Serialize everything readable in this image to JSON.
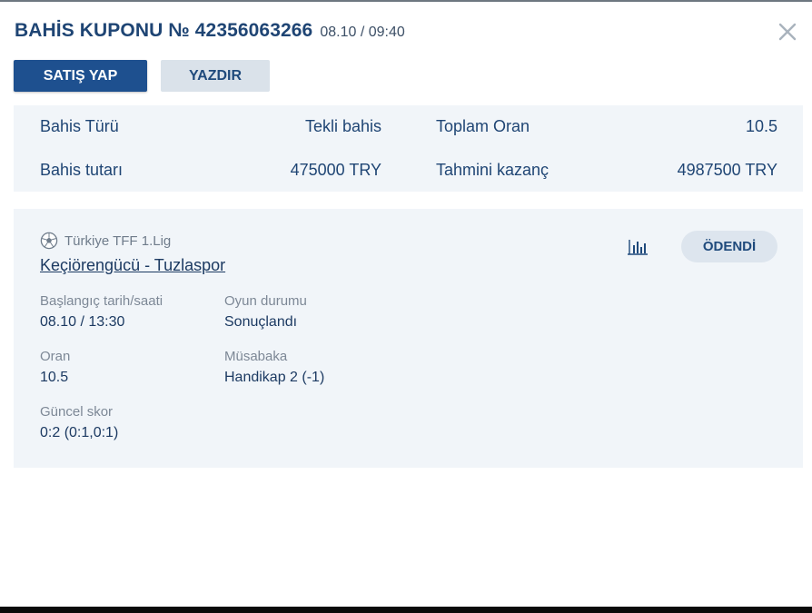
{
  "header": {
    "title": "BAHİS KUPONU № 42356063266",
    "datetime": "08.10 / 09:40"
  },
  "actions": {
    "sell_label": "SATIŞ YAP",
    "print_label": "YAZDIR"
  },
  "summary": {
    "bet_type_label": "Bahis Türü",
    "bet_type_value": "Tekli bahis",
    "total_odds_label": "Toplam Oran",
    "total_odds_value": "10.5",
    "stake_label": "Bahis tutarı",
    "stake_value": "475000 TRY",
    "potential_win_label": "Tahmini kazanç",
    "potential_win_value": "4987500 TRY"
  },
  "event": {
    "league_icon": "soccer-ball-icon",
    "league": "Türkiye TFF 1.Lig",
    "match": "Keçiörengücü - Tuzlaspor",
    "status": "ÖDENDİ",
    "start_label": "Başlangıç tarih/saati",
    "start_value": "08.10 / 13:30",
    "game_status_label": "Oyun durumu",
    "game_status_value": "Sonuçlandı",
    "odds_label": "Oran",
    "odds_value": "10.5",
    "market_label": "Müsabaka",
    "market_value": "Handikap 2 (-1)",
    "score_label": "Güncel skor",
    "score_value": "0:2 (0:1,0:1)"
  },
  "colors": {
    "primary": "#1e508f",
    "secondary_button": "#dae2ea",
    "panel_bg": "#f1f5f9",
    "text_dark": "#1c3a62",
    "text_muted": "#7d8896"
  }
}
